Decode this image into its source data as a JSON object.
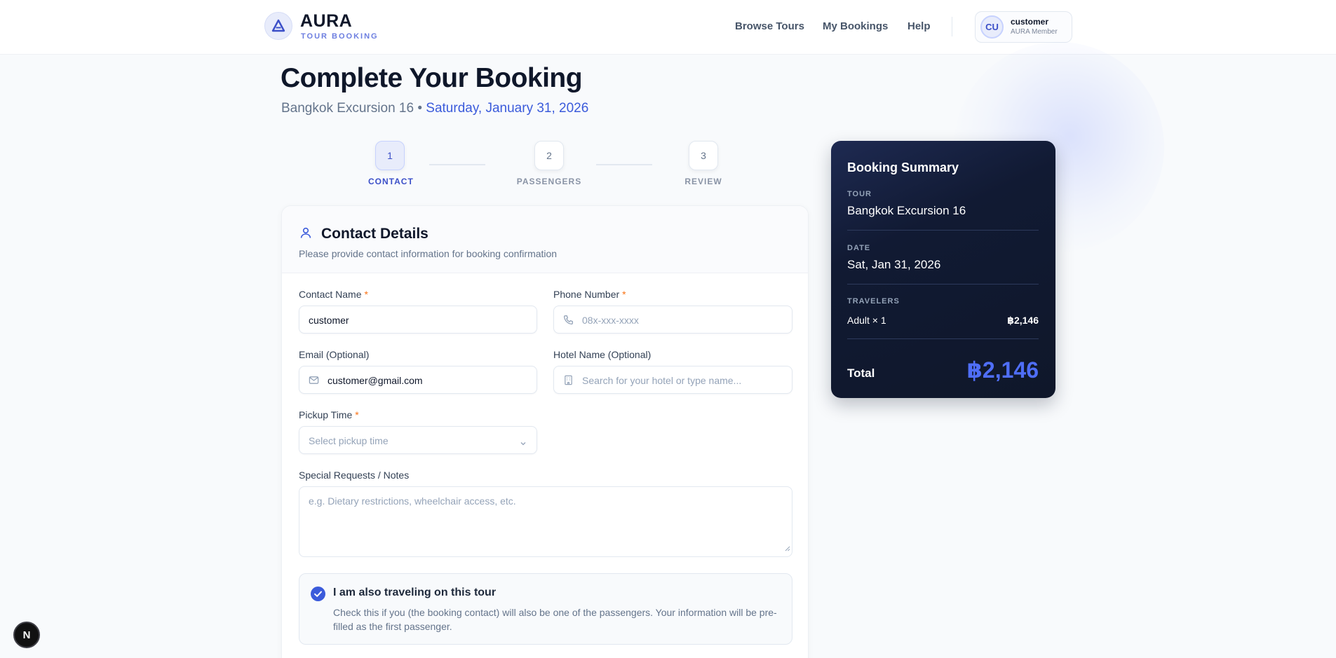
{
  "header": {
    "brand": "AURA",
    "tagline": "TOUR BOOKING",
    "nav": [
      "Browse Tours",
      "My Bookings",
      "Help"
    ],
    "user": {
      "initials": "CU",
      "name": "customer",
      "role": "AURA Member"
    }
  },
  "page": {
    "title": "Complete Your Booking",
    "tour_name": "Bangkok Excursion 16",
    "separator": " • ",
    "date": "Saturday, January 31, 2026"
  },
  "stepper": [
    {
      "number": "1",
      "label": "CONTACT",
      "active": true
    },
    {
      "number": "2",
      "label": "PASSENGERS",
      "active": false
    },
    {
      "number": "3",
      "label": "REVIEW",
      "active": false
    }
  ],
  "form": {
    "title": "Contact Details",
    "description": "Please provide contact information for booking confirmation",
    "required_mark": "*",
    "contact_name": {
      "label": "Contact Name",
      "value": "customer"
    },
    "phone": {
      "label": "Phone Number",
      "placeholder": "08x-xxx-xxxx"
    },
    "email": {
      "label": "Email (Optional)",
      "value": "customer@gmail.com"
    },
    "hotel": {
      "label": "Hotel Name (Optional)",
      "placeholder": "Search for your hotel or type name..."
    },
    "pickup": {
      "label": "Pickup Time",
      "placeholder": "Select pickup time"
    },
    "notes": {
      "label": "Special Requests / Notes",
      "placeholder": "e.g. Dietary restrictions, wheelchair access, etc."
    },
    "traveling": {
      "checked": true,
      "title": "I am also traveling on this tour",
      "description": "Check this if you (the booking contact) will also be one of the passengers. Your information will be pre-filled as the first passenger."
    }
  },
  "summary": {
    "title": "Booking Summary",
    "tour_label": "TOUR",
    "tour_value": "Bangkok Excursion 16",
    "date_label": "DATE",
    "date_value": "Sat, Jan 31, 2026",
    "travelers_label": "TRAVELERS",
    "travelers_value": "Adult × 1",
    "travelers_price": "฿2,146",
    "total_label": "Total",
    "total_value": "฿2,146"
  },
  "corner_badge": "N",
  "colors": {
    "accent": "#3b5bdb",
    "required": "#f97316",
    "summary_bg": "#0f172a",
    "total": "#4f6ef7"
  },
  "icons": [
    "aura-logo-icon",
    "user-icon",
    "phone-icon",
    "mail-icon",
    "building-icon",
    "chevron-down-icon",
    "check-circle-icon"
  ]
}
